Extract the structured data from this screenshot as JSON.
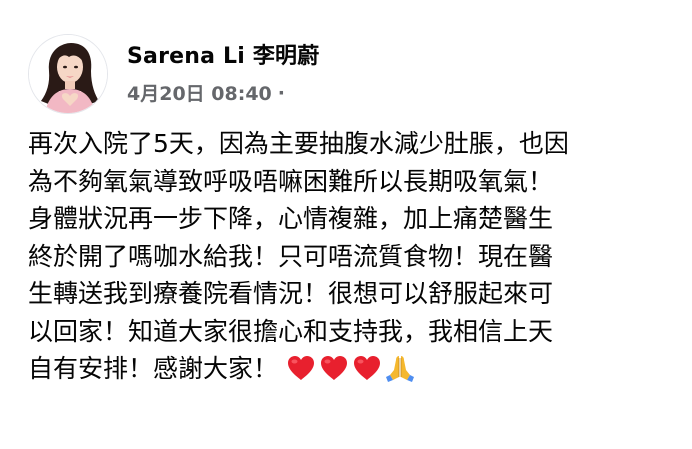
{
  "post": {
    "author_name": "Sarena Li 李明蔚",
    "date": "4月20日 08:40",
    "meta_separator": "·",
    "avatar_alt": "Sarena Li",
    "lines": [
      "再次入院了5天，因為主要抽腹水減少肚脹，也因",
      "為不夠氧氣導致呼吸唔嘛困難所以長期吸氧氣！",
      "身體狀況再一步下降，心情複雜，加上痛楚醫生",
      "終於開了嗎咖水給我！只可唔流質食物！現在醫",
      "生轉送我到療養院看情況！很想可以舒服起來可",
      "以回家！知道大家很擔心和支持我，我相信上天",
      "自有安排！感謝大家！"
    ],
    "emojis": [
      "red-heart",
      "red-heart",
      "red-heart",
      "folded-hands"
    ]
  },
  "colors": {
    "text_primary": "#050505",
    "text_secondary": "#65676b",
    "heart": "#e8202e",
    "hands": "#f5b82e"
  }
}
